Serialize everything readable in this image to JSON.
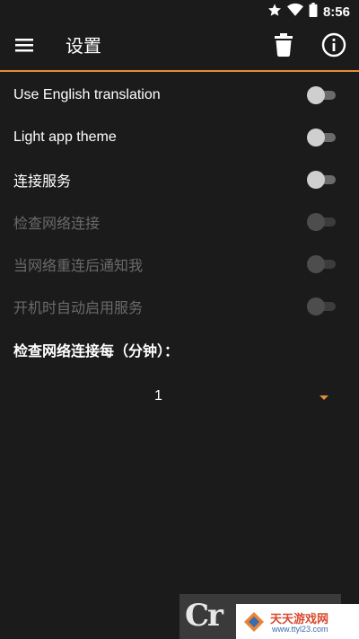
{
  "status_bar": {
    "time": "8:56",
    "icons": [
      "star-icon",
      "wifi-icon",
      "battery-icon"
    ]
  },
  "toolbar": {
    "title": "设置",
    "menu_icon": "menu-icon",
    "delete_icon": "trash-icon",
    "info_icon": "info-icon",
    "accent_color": "#e38d3a"
  },
  "settings": [
    {
      "label": "Use English translation",
      "checked": false,
      "enabled": true
    },
    {
      "label": "Light app theme",
      "checked": false,
      "enabled": true
    },
    {
      "label": "连接服务",
      "checked": false,
      "enabled": true
    },
    {
      "label": "检查网络连接",
      "checked": false,
      "enabled": false
    },
    {
      "label": "当网络重连后通知我",
      "checked": false,
      "enabled": false
    },
    {
      "label": "开机时自动启用服务",
      "checked": false,
      "enabled": false
    }
  ],
  "interval": {
    "heading": "检查网络连接每（分钟）：",
    "selected_value": "1"
  },
  "watermark": {
    "logo_text": "Cr",
    "site_name": "天天游戏网",
    "site_url": "www.ttyl23.com"
  }
}
